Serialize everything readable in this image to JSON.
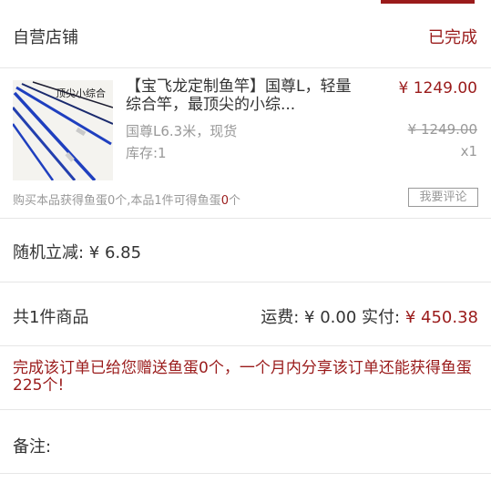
{
  "shop": {
    "name": "自营店铺",
    "status": "已完成"
  },
  "product": {
    "thumb_text": "顶尖小综合",
    "title": "【宝飞龙定制鱼竿】国尊L，轻量综合竿，最顶尖的小综...",
    "price": "¥ 1249.00",
    "spec": "国尊L6.3米，现货",
    "original_price": "¥ 1249.00",
    "stock": "库存:1",
    "quantity": "x1"
  },
  "egg_note": {
    "prefix": "购买本品获得鱼蛋0个,本品1件可得鱼蛋",
    "count": "0",
    "suffix": "个"
  },
  "review_button": "我要评论",
  "discount": "随机立减:  ¥ 6.85",
  "summary": {
    "total_count": "共1件商品",
    "shipping": "运费:  ¥ 0.00",
    "paid_label": "实付:",
    "paid_value": "¥ 450.38"
  },
  "reward": "完成该订单已给您赠送鱼蛋0个，一个月内分享该订单还能获得鱼蛋225个!",
  "remark_label": "备注:",
  "colors": {
    "accent": "#9a1b1b",
    "muted": "#999999",
    "rod_blue": "#1f3fbf"
  }
}
